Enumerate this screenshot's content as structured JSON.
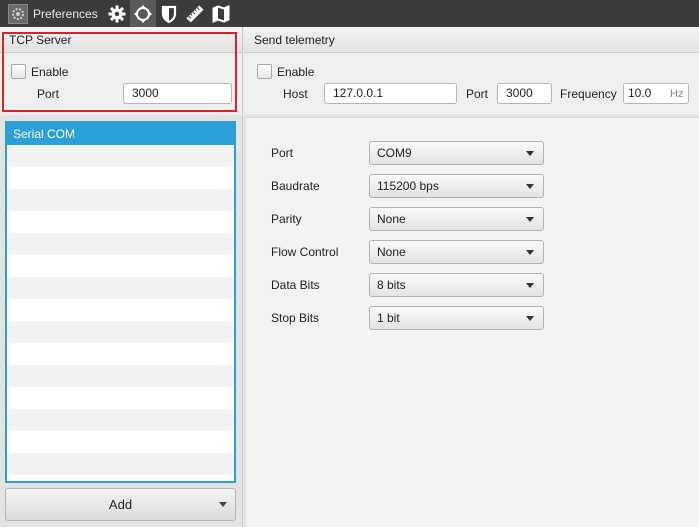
{
  "window": {
    "title": "Preferences"
  },
  "toolbar": {
    "icons": [
      "gear-icon",
      "joystick-icon",
      "shield-icon",
      "ruler-icon",
      "map-icon"
    ],
    "active_index": 1
  },
  "tcp_server": {
    "title": "TCP Server",
    "enable_label": "Enable",
    "enable_checked": false,
    "port_label": "Port",
    "port_value": "3000"
  },
  "telemetry": {
    "title": "Send telemetry",
    "enable_label": "Enable",
    "enable_checked": false,
    "host_label": "Host",
    "host_value": "127.0.0.1",
    "port_label": "Port",
    "port_value": "3000",
    "frequency_label": "Frequency",
    "frequency_value": "10.0",
    "frequency_unit": "Hz"
  },
  "device_list": {
    "items": [
      "Serial COM"
    ],
    "selected_index": 0,
    "add_label": "Add"
  },
  "serial": {
    "rows": [
      {
        "label": "Port",
        "value": "COM9"
      },
      {
        "label": "Baudrate",
        "value": "115200 bps"
      },
      {
        "label": "Parity",
        "value": "None"
      },
      {
        "label": "Flow Control",
        "value": "None"
      },
      {
        "label": "Data Bits",
        "value": "8 bits"
      },
      {
        "label": "Stop Bits",
        "value": "1 bit"
      }
    ]
  },
  "colors": {
    "toolbar_bg": "#3b3b3b",
    "selection": "#2aa0d6",
    "highlight_border": "#d8232a"
  }
}
